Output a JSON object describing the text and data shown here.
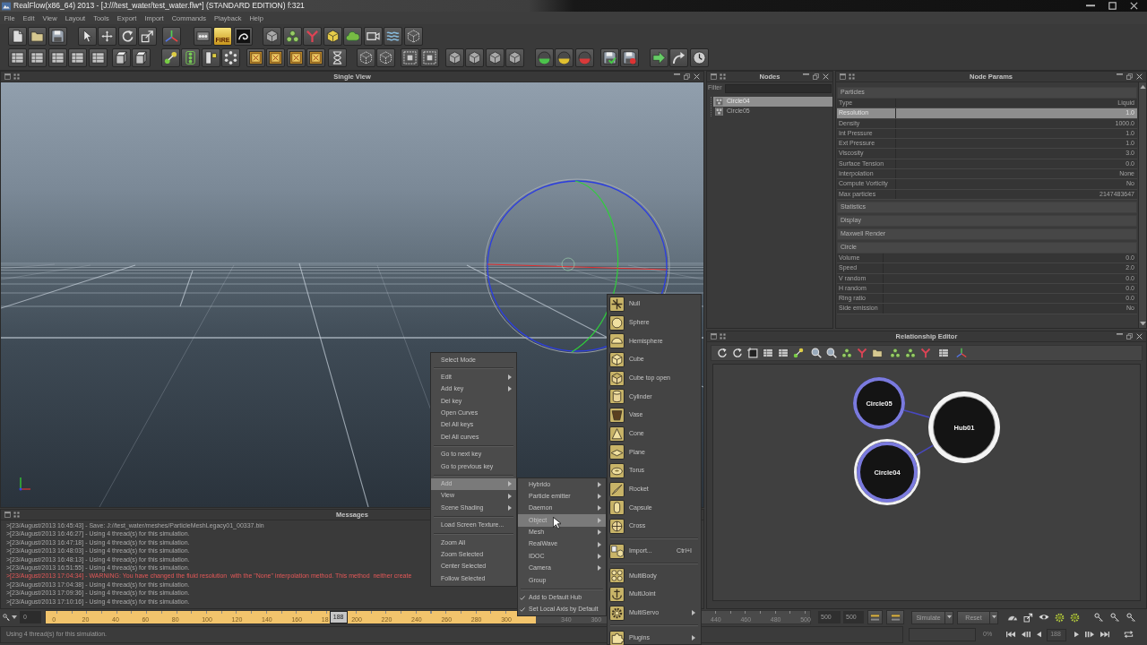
{
  "window": {
    "title": "RealFlow(x86_64) 2013 - [J:///test_water/test_water.flw*] (STANDARD EDITION) f:321"
  },
  "menu_bar": [
    "File",
    "Edit",
    "View",
    "Layout",
    "Tools",
    "Export",
    "Import",
    "Commands",
    "Playback",
    "Help"
  ],
  "toolbar": {
    "fire_label": "FIRE"
  },
  "single_view": {
    "title": "Single View"
  },
  "messages": {
    "title": "Messages",
    "lines": [
      {
        "kind": "info",
        "text": ">[23/August/2013 16:45:43] - Save: J://test_water/meshes/ParticleMeshLegacy01_00337.bin"
      },
      {
        "kind": "info",
        "text": ">[23/August/2013 16:46:27] - Using 4 thread(s) for this simulation."
      },
      {
        "kind": "info",
        "text": ">[23/August/2013 16:47:18] - Using 4 thread(s) for this simulation."
      },
      {
        "kind": "info",
        "text": ">[23/August/2013 16:48:03] - Using 4 thread(s) for this simulation."
      },
      {
        "kind": "info",
        "text": ">[23/August/2013 16:48:13] - Using 4 thread(s) for this simulation."
      },
      {
        "kind": "info",
        "text": ">[23/August/2013 16:51:55] - Using 4 thread(s) for this simulation."
      },
      {
        "kind": "warning",
        "text": ">[23/August/2013 17:04:34] - WARNING: You have changed the fluid resolution  with the \"None\" interpolation method. This method  neither create"
      },
      {
        "kind": "info",
        "text": ">[23/August/2013 17:04:38] - Using 4 thread(s) for this simulation."
      },
      {
        "kind": "info",
        "text": ">[23/August/2013 17:09:36] - Using 4 thread(s) for this simulation."
      },
      {
        "kind": "info",
        "text": ">[23/August/2013 17:10:16] - Using 4 thread(s) for this simulation."
      }
    ]
  },
  "nodes": {
    "title": "Nodes",
    "filter_label": "Filter",
    "items": [
      {
        "label": "Circle04",
        "selected": true
      },
      {
        "label": "Circle05",
        "selected": false
      }
    ]
  },
  "node_params": {
    "title": "Node Params",
    "sections": [
      {
        "title": "Particles",
        "rows": [
          {
            "name": "Type",
            "value": "Liquid",
            "selected": false
          },
          {
            "name": "Resolution",
            "value": "1.0",
            "selected": true
          },
          {
            "name": "Density",
            "value": "1000.0",
            "selected": false
          },
          {
            "name": "Int Pressure",
            "value": "1.0",
            "selected": false
          },
          {
            "name": "Ext Pressure",
            "value": "1.0",
            "selected": false
          },
          {
            "name": "Viscosity",
            "value": "3.0",
            "selected": false
          },
          {
            "name": "Surface Tension",
            "value": "0.0",
            "selected": false
          },
          {
            "name": "Interpolation",
            "value": "None",
            "selected": false
          },
          {
            "name": "Compute Vorticity",
            "value": "No",
            "selected": false
          },
          {
            "name": "Max particles",
            "value": "2147483647",
            "selected": false
          }
        ]
      },
      {
        "title": "Statistics"
      },
      {
        "title": "Display"
      },
      {
        "title": "Maxwell Render"
      },
      {
        "title": "Circle",
        "rows": [
          {
            "name": "Volume",
            "value": "0.0",
            "selected": false
          },
          {
            "name": "Speed",
            "value": "2.0",
            "selected": false
          },
          {
            "name": "V random",
            "value": "0.0",
            "selected": false
          },
          {
            "name": "H random",
            "value": "0.0",
            "selected": false
          },
          {
            "name": "Ring ratio",
            "value": "0.0",
            "selected": false
          },
          {
            "name": "Side emission",
            "value": "No",
            "selected": false
          }
        ]
      }
    ]
  },
  "relationship_editor": {
    "title": "Relationship Editor",
    "nodes": [
      {
        "label": "Circle05",
        "kind": "emitter",
        "selected": false
      },
      {
        "label": "Hub01",
        "kind": "hub",
        "selected": false
      },
      {
        "label": "Circle04",
        "kind": "emitter",
        "selected": true
      }
    ]
  },
  "timeline": {
    "start_field": "0",
    "tick_groups": [
      [
        "0",
        "20",
        "40",
        "60",
        "80",
        "100",
        "120",
        "140",
        "160"
      ],
      [
        "18"
      ],
      [
        "200",
        "220",
        "240",
        "260",
        "280",
        "300"
      ],
      [
        "340",
        "360"
      ],
      [
        "440",
        "460",
        "480",
        "500"
      ]
    ],
    "cache": {
      "level": 0.641
    },
    "current_frame": {
      "label": "188",
      "level": 0.382
    }
  },
  "playback_controls": {
    "range_fields": [
      "500",
      "500"
    ],
    "buttons": [
      {
        "label": "Simulate"
      },
      {
        "label": "Reset"
      }
    ],
    "progress_reading": "0%",
    "frame_field": "188"
  },
  "status_bar": {
    "text": "Using 4 thread(s) for this simulation."
  },
  "context_menu": {
    "groups": [
      [
        {
          "label": "Select Mode",
          "submenu": false,
          "selected": false
        }
      ],
      [
        {
          "label": "Edit",
          "submenu": true,
          "selected": false
        },
        {
          "label": "Add key",
          "submenu": true,
          "selected": false
        },
        {
          "label": "Del key",
          "submenu": false,
          "selected": false
        },
        {
          "label": "Open Curves",
          "submenu": false,
          "selected": false
        },
        {
          "label": "Del All keys",
          "submenu": false,
          "selected": false
        },
        {
          "label": "Del All curves",
          "submenu": false,
          "selected": false
        }
      ],
      [
        {
          "label": "Go to next key",
          "submenu": false,
          "selected": false
        },
        {
          "label": "Go to previous key",
          "submenu": false,
          "selected": false
        }
      ],
      [
        {
          "label": "Add",
          "submenu": true,
          "selected": true
        },
        {
          "label": "View",
          "submenu": true,
          "selected": false
        },
        {
          "label": "Scene Shading",
          "submenu": true,
          "selected": false
        }
      ],
      [
        {
          "label": "Load Screen Texture...",
          "submenu": false,
          "selected": false
        }
      ],
      [
        {
          "label": "Zoom All",
          "submenu": false,
          "selected": false
        },
        {
          "label": "Zoom Selected",
          "submenu": false,
          "selected": false
        },
        {
          "label": "Center Selected",
          "submenu": false,
          "selected": false
        },
        {
          "label": "Follow Selected",
          "submenu": false,
          "selected": false
        }
      ]
    ]
  },
  "add_submenu": {
    "groups": [
      [
        {
          "label": "Hybrido",
          "kind": "action",
          "submenu": true,
          "selected": false
        },
        {
          "label": "Particle emitter",
          "kind": "action",
          "submenu": true,
          "selected": false
        },
        {
          "label": "Daemon",
          "kind": "action",
          "submenu": true,
          "selected": false
        },
        {
          "label": "Object",
          "kind": "action",
          "submenu": true,
          "selected": true
        },
        {
          "label": "Mesh",
          "kind": "action",
          "submenu": true,
          "selected": false
        },
        {
          "label": "RealWave",
          "kind": "action",
          "submenu": true,
          "selected": false
        },
        {
          "label": "IDOC",
          "kind": "action",
          "submenu": true,
          "selected": false
        },
        {
          "label": "Camera",
          "kind": "action",
          "submenu": true,
          "selected": false
        },
        {
          "label": "Group",
          "kind": "action",
          "submenu": false,
          "selected": false
        }
      ],
      [
        {
          "label": "Add to Default Hub",
          "kind": "check",
          "checked": true,
          "submenu": false,
          "selected": false
        },
        {
          "label": "Set Local Axis by Default",
          "kind": "check",
          "checked": true,
          "submenu": false,
          "selected": false
        }
      ]
    ]
  },
  "object_submenu": {
    "groups": [
      [
        {
          "label": "Null",
          "submenu": false,
          "selected": false
        },
        {
          "label": "Sphere",
          "submenu": false,
          "selected": false
        },
        {
          "label": "Hemisphere",
          "submenu": false,
          "selected": false
        },
        {
          "label": "Cube",
          "submenu": false,
          "selected": false
        },
        {
          "label": "Cube top open",
          "submenu": false,
          "selected": false
        },
        {
          "label": "Cylinder",
          "submenu": false,
          "selected": false
        },
        {
          "label": "Vase",
          "submenu": false,
          "selected": false
        },
        {
          "label": "Cone",
          "submenu": false,
          "selected": false
        },
        {
          "label": "Plane",
          "submenu": false,
          "selected": false
        },
        {
          "label": "Torus",
          "submenu": false,
          "selected": false
        },
        {
          "label": "Rocket",
          "submenu": false,
          "selected": false
        },
        {
          "label": "Capsule",
          "submenu": false,
          "selected": false
        },
        {
          "label": "Cross",
          "submenu": false,
          "selected": false
        }
      ],
      [
        {
          "label": "Import...",
          "shortcut": "Ctrl+I",
          "submenu": false,
          "selected": false
        }
      ],
      [
        {
          "label": "MultiBody",
          "submenu": false,
          "selected": false
        },
        {
          "label": "MultiJoint",
          "submenu": false,
          "selected": false
        },
        {
          "label": "MultiServo",
          "submenu": true,
          "selected": false
        }
      ],
      [
        {
          "label": "Plugins",
          "submenu": true,
          "selected": false
        }
      ]
    ]
  }
}
